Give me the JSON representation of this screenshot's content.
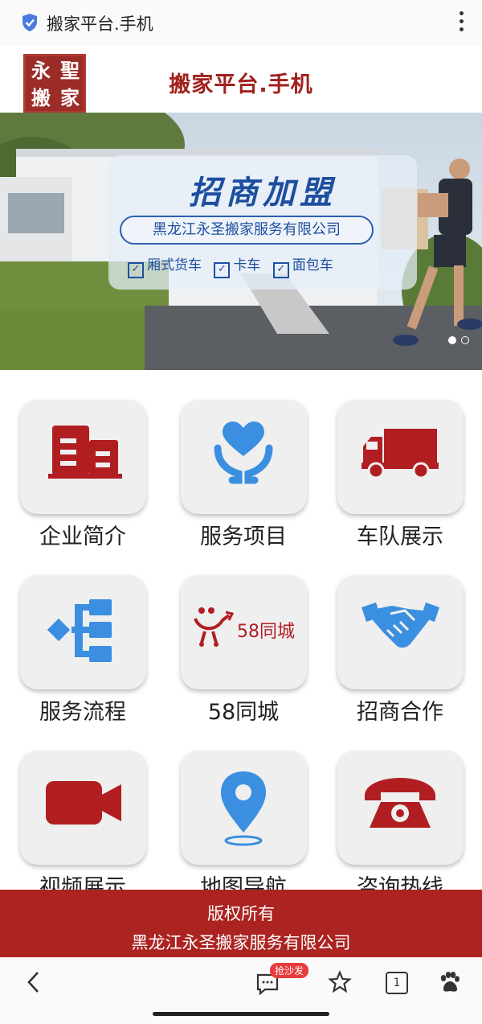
{
  "browser": {
    "title": "搬家平台.手机",
    "bottom_badge": "抢沙发",
    "tab_count": "1"
  },
  "header": {
    "seal_chars": [
      "永",
      "聖",
      "搬",
      "家"
    ],
    "site_title": "搬家平台.手机"
  },
  "banner": {
    "headline": "招商加盟",
    "company": "黑龙江永圣搬家服务有限公司",
    "vehicles": [
      "厢式货车",
      "卡车",
      "面包车"
    ],
    "slide_count": 2,
    "active_slide": 1
  },
  "grid": [
    {
      "label": "企业简介",
      "icon": "building-icon"
    },
    {
      "label": "服务项目",
      "icon": "heart-hands-icon"
    },
    {
      "label": "车队展示",
      "icon": "truck-icon"
    },
    {
      "label": "服务流程",
      "icon": "flow-chart-icon"
    },
    {
      "label": "58同城",
      "icon": "58tongcheng-logo-icon",
      "logo_text": "58同城"
    },
    {
      "label": "招商合作",
      "icon": "handshake-icon"
    },
    {
      "label": "视频展示",
      "icon": "video-camera-icon"
    },
    {
      "label": "地图导航",
      "icon": "map-pin-icon"
    },
    {
      "label": "咨询热线",
      "icon": "telephone-icon"
    }
  ],
  "footer": {
    "copyright": "版权所有",
    "company": "黑龙江永圣搬家服务有限公司"
  },
  "colors": {
    "brand_red": "#a1211d",
    "icon_blue": "#3b8fe0",
    "footer_red": "#ab2421"
  }
}
